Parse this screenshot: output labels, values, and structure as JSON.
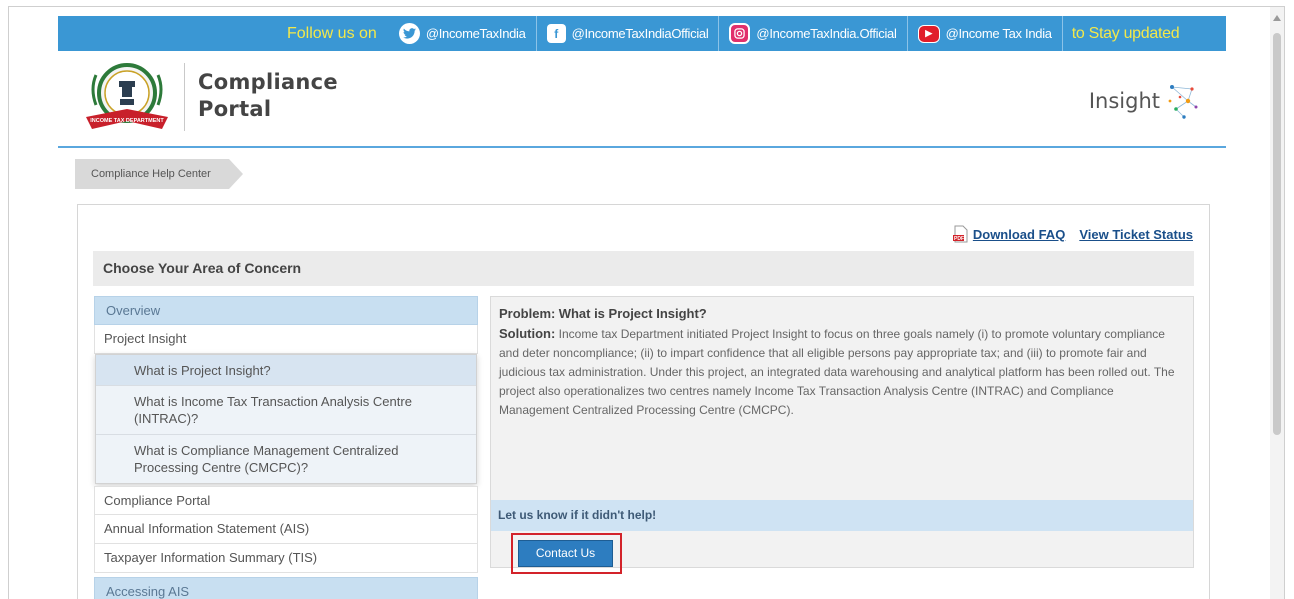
{
  "social_bar": {
    "follow_label": "Follow us on",
    "twitter": "@IncomeTaxIndia",
    "facebook": "@IncomeTaxIndiaOfficial",
    "instagram": "@IncomeTaxIndia.Official",
    "youtube": "@Income Tax India",
    "stay_label": "to Stay updated"
  },
  "header": {
    "portal_title_line1": "Compliance",
    "portal_title_line2": "Portal",
    "insight_label": "Insight",
    "emblem_text": "INCOME TAX DEPARTMENT"
  },
  "breadcrumb": {
    "current": "Compliance Help Center"
  },
  "top_links": {
    "download_faq": "Download FAQ",
    "view_ticket_status": "View Ticket Status"
  },
  "area_heading": "Choose Your Area of Concern",
  "sidebar": {
    "overview": "Overview",
    "project_insight": "Project Insight",
    "questions": [
      "What is Project Insight?",
      "What is Income Tax Transaction Analysis Centre (INTRAC)?",
      "What is Compliance Management Centralized Processing Centre (CMCPC)?"
    ],
    "items": [
      "Compliance Portal",
      "Annual Information Statement (AIS)",
      "Taxpayer Information Summary (TIS)"
    ],
    "accessing_ais": "Accessing AIS"
  },
  "answer": {
    "problem_label": "Problem:",
    "problem_text": "What is Project Insight?",
    "solution_label": "Solution:",
    "solution_text": "Income tax Department initiated Project Insight to focus on three goals namely (i) to promote voluntary compliance and deter noncompliance; (ii) to impart confidence that all eligible persons pay appropriate tax; and (iii) to promote fair and judicious tax administration. Under this project, an integrated data warehousing and analytical platform has been rolled out. The project also operationalizes two centres namely Income Tax Transaction Analysis Centre (INTRAC) and Compliance Management Centralized Processing Centre (CMCPC)."
  },
  "help": {
    "prompt": "Let us know if it didn't help!",
    "contact_button": "Contact Us"
  },
  "colors": {
    "social_bar": "#3a97d4",
    "accent_yellow": "#f3e84a",
    "accordion_head": "#c8dff1",
    "contact_button": "#2d7dc0",
    "highlight_box": "#d3232a"
  }
}
